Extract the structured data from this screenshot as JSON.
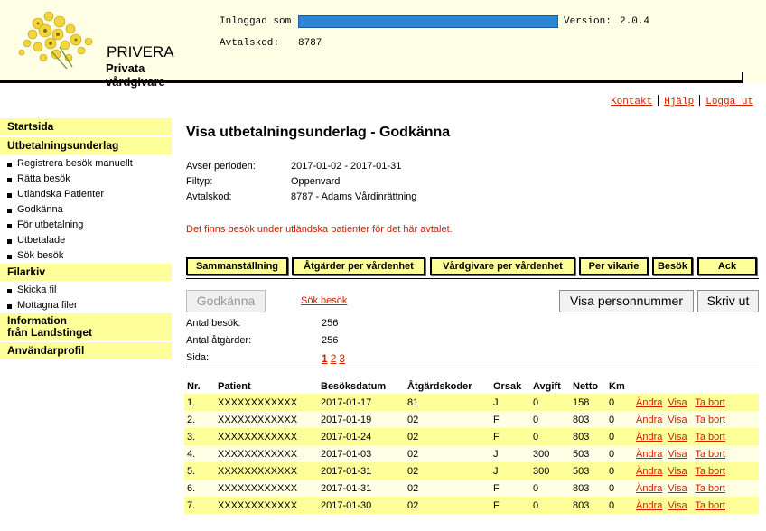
{
  "header": {
    "brand": "PRIVERA",
    "brand_sub": "Privata vårdgivare",
    "login_label": "Inloggad som:",
    "version_label": "Version:",
    "version_value": "2.0.4",
    "avtal_label": "Avtalskod:",
    "avtal_value": "8787",
    "login_bar_color": "#2c86d6"
  },
  "toplinks": {
    "kontakt": "Kontakt",
    "hjalp": "Hjälp",
    "logga_ut": "Logga ut"
  },
  "sidebar": {
    "startsida": "Startsida",
    "utbetalningsunderlag": "Utbetalningsunderlag",
    "items": [
      "Registrera besök manuellt",
      "Rätta besök",
      "Utländska Patienter",
      "Godkänna",
      "För utbetalning",
      "Utbetalade",
      "Sök besök"
    ],
    "filarkiv": "Filarkiv",
    "filarkiv_items": [
      "Skicka fil",
      "Mottagna filer"
    ],
    "information": "Information",
    "information2": "från Landstinget",
    "anvandarprofil": "Användarprofil"
  },
  "main": {
    "title": "Visa utbetalningsunderlag - Godkänna",
    "period_label": "Avser perioden:",
    "period_value": "2017-01-02 - 2017-01-31",
    "filtyp_label": "Filtyp:",
    "filtyp_value": "Oppenvard",
    "avtal_label": "Avtalskod:",
    "avtal_value": "8787 - Adams Vårdinrättning",
    "warning": "Det finns besök under utländska patienter för det här avtalet.",
    "tabs": [
      "Sammanställning",
      "Åtgärder per vårdenhet",
      "Vårdgivare per vårdenhet",
      "Per vikarie",
      "Besök",
      "Ack"
    ],
    "godkanna_label": "Godkänna",
    "sok_label": "Sök besök",
    "visa_pnr_label": "Visa personnummer",
    "skriv_ut_label": "Skriv ut",
    "antal_besok_label": "Antal besök:",
    "antal_besok_value": "256",
    "antal_atgarder_label": "Antal åtgärder:",
    "antal_atgarder_value": "256",
    "sida_label": "Sida:",
    "pages": [
      "1",
      "2",
      "3"
    ]
  },
  "table": {
    "headers": [
      "Nr.",
      "Patient",
      "Besöksdatum",
      "Åtgärdskoder",
      "Orsak",
      "Avgift",
      "Netto",
      "Km"
    ],
    "action_andra": "Ändra",
    "action_visa": "Visa",
    "action_tabort": "Ta bort",
    "rows": [
      [
        "1.",
        "XXXXXXXXXXXX",
        "2017-01-17",
        "81",
        "J",
        "0",
        "158",
        "0"
      ],
      [
        "2.",
        "XXXXXXXXXXXX",
        "2017-01-19",
        "02",
        "F",
        "0",
        "803",
        "0"
      ],
      [
        "3.",
        "XXXXXXXXXXXX",
        "2017-01-24",
        "02",
        "F",
        "0",
        "803",
        "0"
      ],
      [
        "4.",
        "XXXXXXXXXXXX",
        "2017-01-03",
        "02",
        "J",
        "300",
        "503",
        "0"
      ],
      [
        "5.",
        "XXXXXXXXXXXX",
        "2017-01-31",
        "02",
        "J",
        "300",
        "503",
        "0"
      ],
      [
        "6.",
        "XXXXXXXXXXXX",
        "2017-01-31",
        "02",
        "F",
        "0",
        "803",
        "0"
      ],
      [
        "7.",
        "XXXXXXXXXXXX",
        "2017-01-30",
        "02",
        "F",
        "0",
        "803",
        "0"
      ]
    ]
  }
}
